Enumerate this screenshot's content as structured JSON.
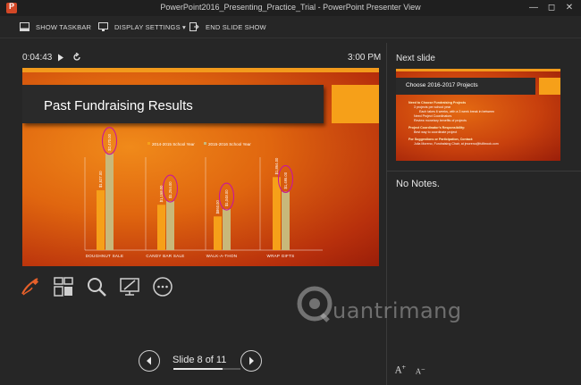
{
  "window": {
    "title": "PowerPoint2016_Presenting_Practice_Trial - PowerPoint Presenter View"
  },
  "toolbar": {
    "show_taskbar": "SHOW TASKBAR",
    "display_settings": "DISPLAY SETTINGS ▾",
    "end_slide_show": "END SLIDE SHOW"
  },
  "timer": {
    "elapsed": "0:04:43",
    "clock": "3:00 PM"
  },
  "slide": {
    "title": "Past Fundraising Results",
    "legend": [
      "2014-2015 School Year",
      "2015-2016 School Year"
    ]
  },
  "chart_data": {
    "type": "bar",
    "categories": [
      "DOUGHNUT SALE",
      "CANDY BAR SALE",
      "WALK-A-THON",
      "WRAP GIFTS"
    ],
    "series": [
      {
        "name": "2014-2015 School Year",
        "values": [
          1527,
          1158,
          860,
          1864
        ]
      },
      {
        "name": "2015-2016 School Year",
        "values": [
          2470,
          1254,
          1048,
          1495
        ]
      }
    ],
    "value_labels": [
      [
        "$1,527.00",
        "$2,470.00"
      ],
      [
        "$1,158.00",
        "$1,254.00"
      ],
      [
        "$860.00",
        "$1,048.00"
      ],
      [
        "$1,864.00",
        "$1,495.00"
      ]
    ],
    "colors": [
      "#f6a019",
      "#c8b87a"
    ]
  },
  "navigation": {
    "slide_label": "Slide 8 of 11",
    "progress": 0.727
  },
  "next": {
    "label": "Next slide",
    "title": "Choose 2016-2017 Projects",
    "lines": [
      "Need to Choose Fundraising Projects",
      "3 projects per school year",
      "Each takes 6 weeks, with a 3 week break in between",
      "Need Project Coordinators",
      "Review monetary benefits of projects",
      "Project Coordinator's Responsibility:",
      "Best way to coordinate project",
      "For Suggestions or Participation, Contact:",
      "Julia Moreno, Fundraising Chair, at jmoreno@fullbrook.com"
    ]
  },
  "notes": {
    "text": "No Notes."
  },
  "font_controls": {
    "increase": "A",
    "decrease": "A"
  },
  "watermark": {
    "text": "uantrimang"
  },
  "colors": {
    "accent": "#d24726",
    "background": "#262626"
  }
}
